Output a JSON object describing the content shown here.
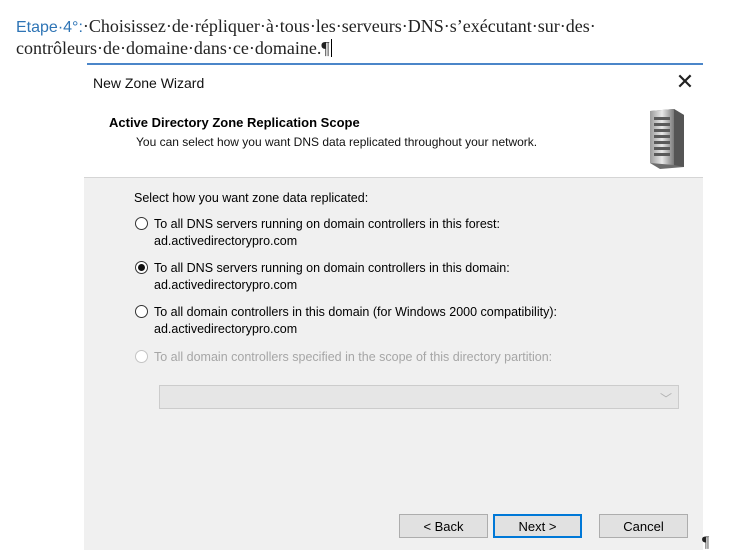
{
  "document": {
    "step_prefix": "Etape·4°:",
    "line1_text": "·Choisissez·de·répliquer·à·tous·les·serveurs·DNS·s’exécutant·sur·des·",
    "line2_text": "contrôleurs·de·domaine·dans·ce·domaine.¶",
    "trailing_mark": "¶"
  },
  "dialog": {
    "title": "New Zone Wizard",
    "close_glyph": "✕",
    "header_title": "Active Directory Zone Replication Scope",
    "header_subtitle": "You can select how you want DNS data replicated throughout your network.",
    "prompt": "Select how you want zone data replicated:",
    "options": [
      {
        "label": "To all DNS servers running on domain controllers in this forest:",
        "sub": "ad.activedirectorypro.com",
        "checked": false,
        "enabled": true
      },
      {
        "label": "To all DNS servers running on domain controllers in this domain:",
        "sub": "ad.activedirectorypro.com",
        "checked": true,
        "enabled": true
      },
      {
        "label": "To all domain controllers in this domain (for Windows 2000 compatibility):",
        "sub": "ad.activedirectorypro.com",
        "checked": false,
        "enabled": true
      },
      {
        "label": "To all domain controllers specified in the scope of this directory partition:",
        "sub": "",
        "checked": false,
        "enabled": false
      }
    ],
    "partition_select_value": "",
    "buttons": {
      "back": "< Back",
      "next": "Next >",
      "cancel": "Cancel"
    }
  },
  "colors": {
    "accent": "#0078d7",
    "step_prefix": "#2e74b5",
    "dialog_bg": "#f0f0f0"
  }
}
